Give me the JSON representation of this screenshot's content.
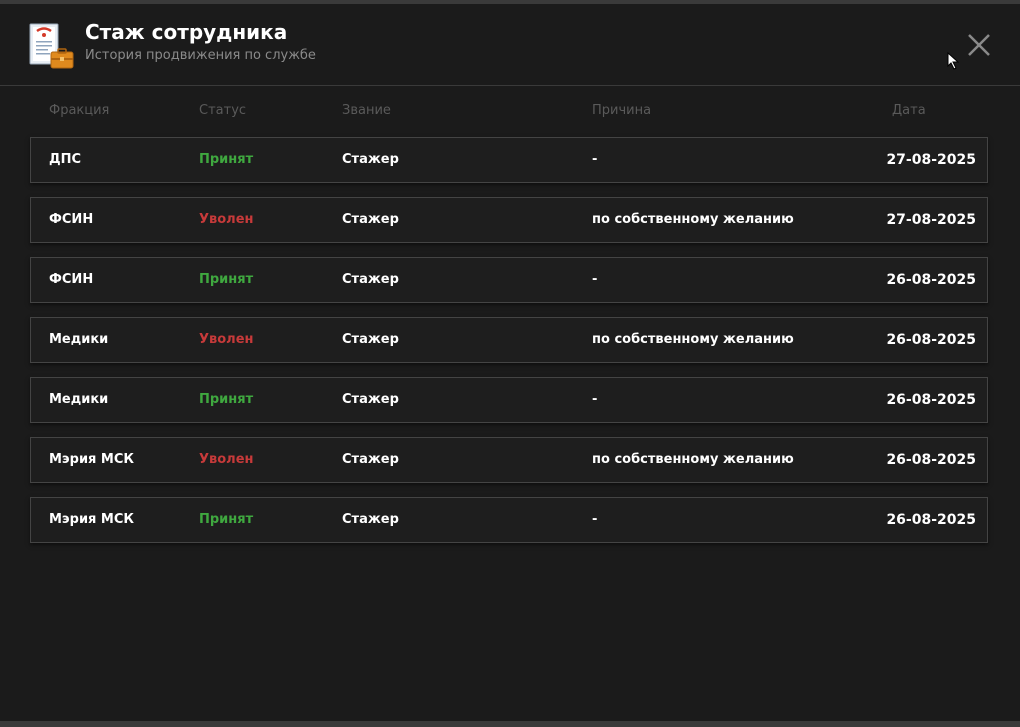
{
  "header": {
    "title": "Стаж сотрудника",
    "subtitle": "История продвижения по службе"
  },
  "colors": {
    "accepted": "#3fa83f",
    "dismissed": "#c73a3a"
  },
  "table": {
    "columns": [
      "Фракция",
      "Статус",
      "Звание",
      "Причина",
      "Дата"
    ],
    "rows": [
      {
        "fraction": "ДПС",
        "status": "Принят",
        "status_type": "accepted",
        "rank": "Стажер",
        "reason": "-",
        "date": "27-08-2025"
      },
      {
        "fraction": "ФСИН",
        "status": "Уволен",
        "status_type": "dismissed",
        "rank": "Стажер",
        "reason": "по собственному желанию",
        "date": "27-08-2025"
      },
      {
        "fraction": "ФСИН",
        "status": "Принят",
        "status_type": "accepted",
        "rank": "Стажер",
        "reason": "-",
        "date": "26-08-2025"
      },
      {
        "fraction": "Медики",
        "status": "Уволен",
        "status_type": "dismissed",
        "rank": "Стажер",
        "reason": "по собственному желанию",
        "date": "26-08-2025"
      },
      {
        "fraction": "Медики",
        "status": "Принят",
        "status_type": "accepted",
        "rank": "Стажер",
        "reason": "-",
        "date": "26-08-2025"
      },
      {
        "fraction": "Мэрия МСК",
        "status": "Уволен",
        "status_type": "dismissed",
        "rank": "Стажер",
        "reason": "по собственному желанию",
        "date": "26-08-2025"
      },
      {
        "fraction": "Мэрия МСК",
        "status": "Принят",
        "status_type": "accepted",
        "rank": "Стажер",
        "reason": "-",
        "date": "26-08-2025"
      }
    ]
  }
}
